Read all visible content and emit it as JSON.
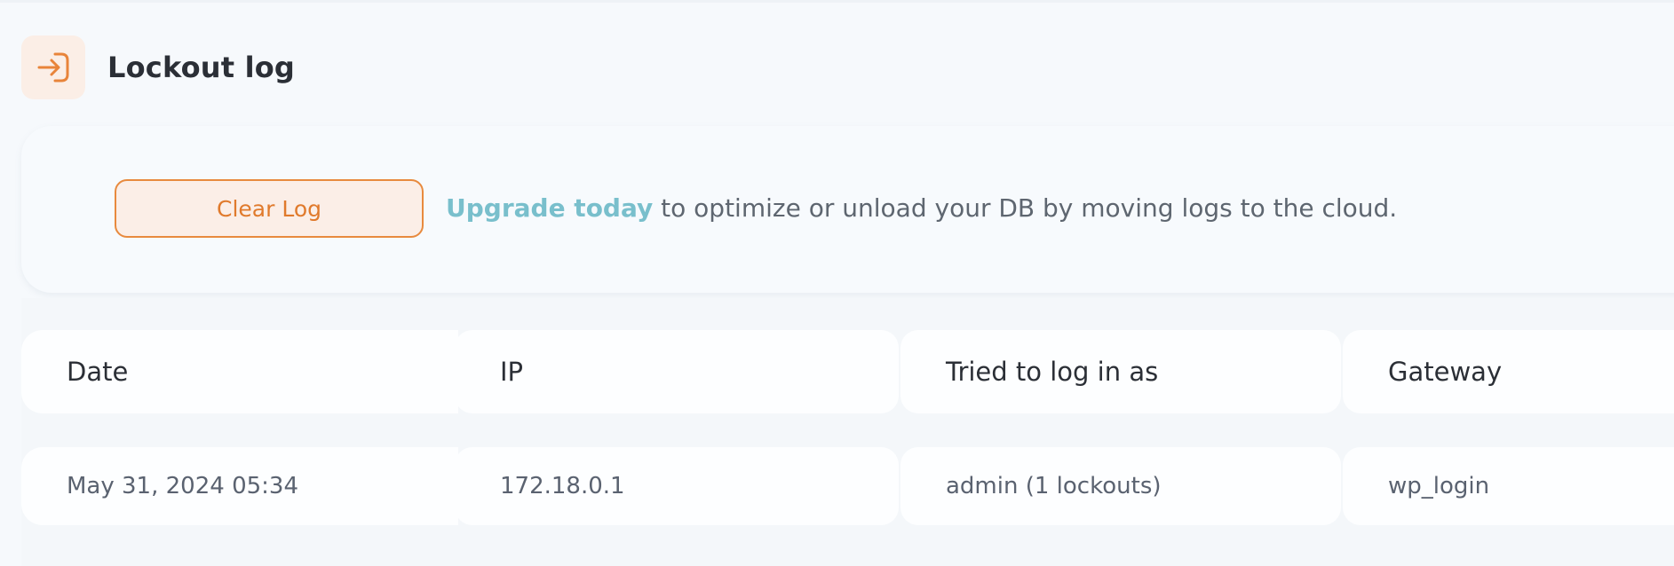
{
  "section": {
    "title": "Lockout log",
    "icon": "login-arrow-icon"
  },
  "actions": {
    "clear_log_label": "Clear Log",
    "upgrade_link_text": "Upgrade today",
    "upgrade_message": " to optimize or unload your DB by moving logs to the cloud."
  },
  "table": {
    "headers": {
      "date": "Date",
      "ip": "IP",
      "username": "Tried to log in as",
      "gateway": "Gateway"
    },
    "rows": [
      {
        "date": "May 31, 2024 05:34",
        "ip": "172.18.0.1",
        "username": "admin (1 lockouts)",
        "gateway": "wp_login"
      }
    ]
  },
  "colors": {
    "accent_orange": "#e88a3e",
    "link_teal": "#79bfcc",
    "icon_bg": "#fbeee6"
  }
}
